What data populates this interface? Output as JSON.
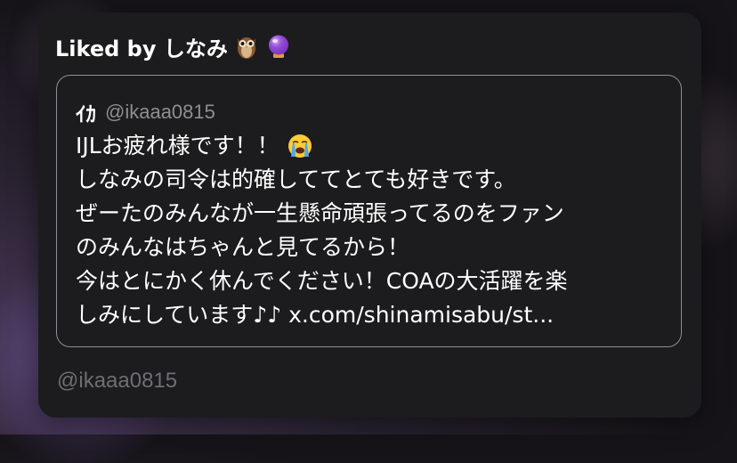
{
  "header": {
    "liked_by": "Liked by しなみ"
  },
  "icons": {
    "header_emoji_1": "owl-emoji-icon",
    "header_emoji_2": "crystal-ball-emoji-icon",
    "tweet_emoji": "loudly-crying-face-emoji-icon"
  },
  "quote": {
    "author_name": "ｲｶ",
    "author_handle": "@ikaaa0815",
    "lines": [
      "IJLお疲れ様です！！",
      "しなみの司令は的確しててとても好きです。",
      "ぜーたのみんなが一生懸命頑張ってるのをファン",
      "のみんなはちゃんと見てるから！",
      "今はとにかく休んでください！COAの大活躍を楽",
      "しみにしています♪♪ x.com/shinamisabu/st..."
    ]
  },
  "footer": {
    "handle": "@ikaaa0815"
  },
  "colors": {
    "card_bg": "#1c1c1e",
    "border": "#8e8e93",
    "secondary_text": "#8e8e93",
    "footer_text": "#6e6e73"
  }
}
